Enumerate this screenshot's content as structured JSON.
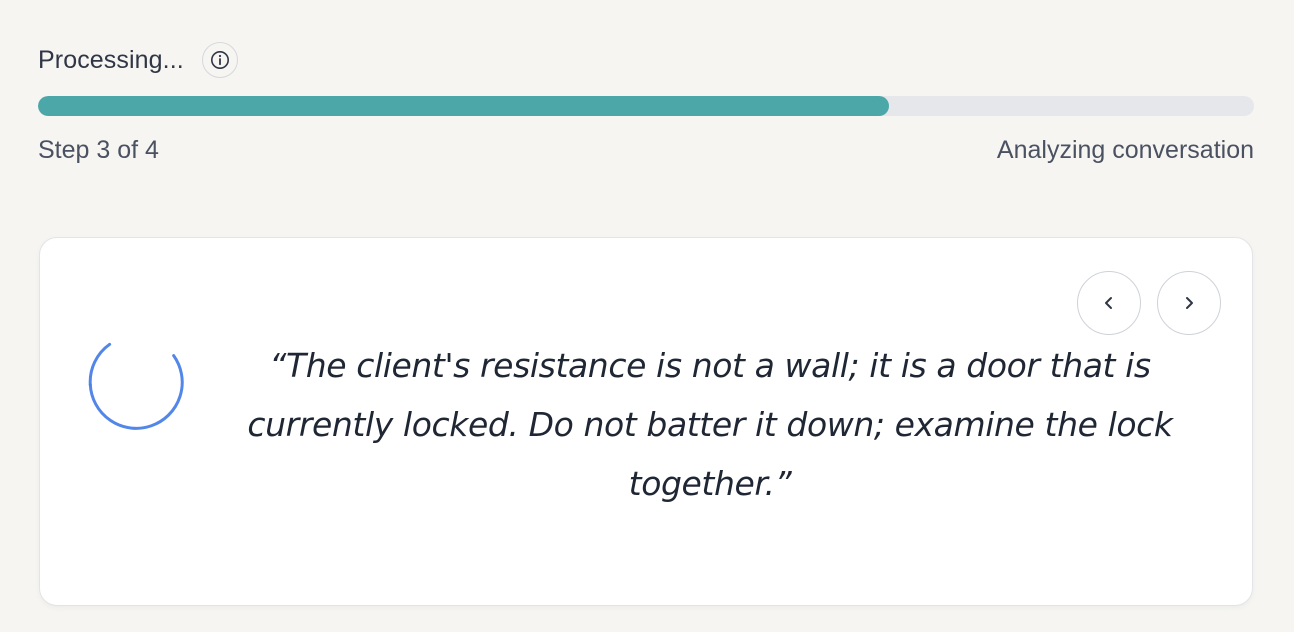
{
  "header": {
    "status_title": "Processing...",
    "info_icon": "info-icon"
  },
  "progress": {
    "fraction": 0.7,
    "step_label": "Step 3 of 4",
    "stage_label": "Analyzing conversation",
    "fill_color": "#4ca8a8",
    "track_color": "#e5e7eb"
  },
  "quote_card": {
    "quote": "“The client's resistance is not a wall; it is a door that is currently locked. Do not batter it down; examine the lock together.”",
    "prev_icon": "chevron-left-icon",
    "next_icon": "chevron-right-icon",
    "spinner_color": "#4a7fe8"
  }
}
